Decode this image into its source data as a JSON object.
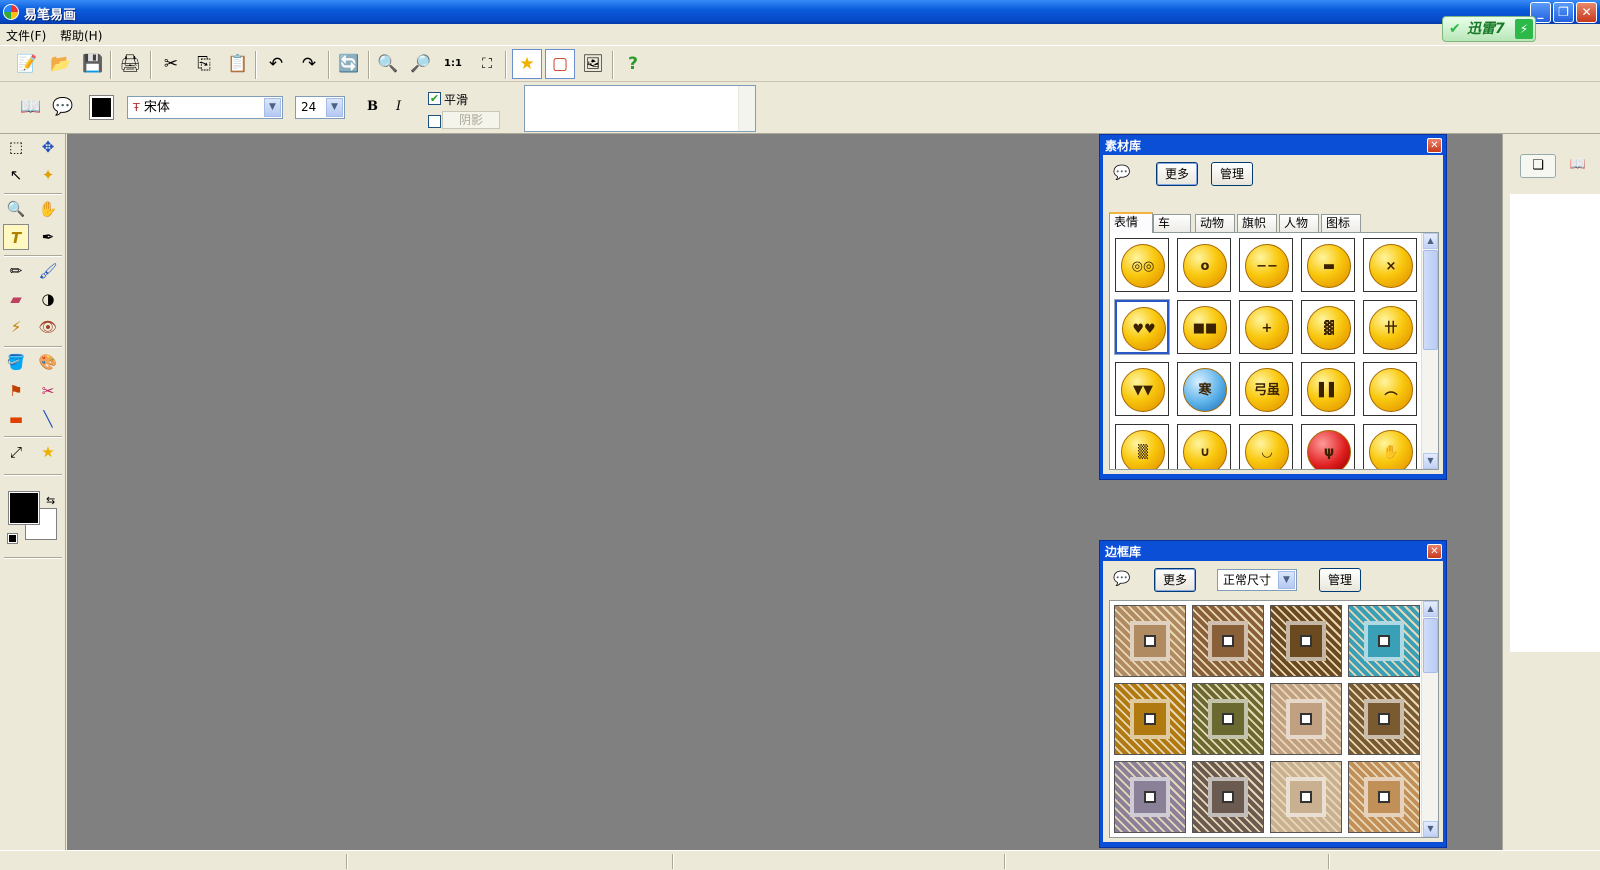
{
  "window": {
    "title": "易笔易画"
  },
  "badge": {
    "label": "迅雷7",
    "bolt": "⚡"
  },
  "menu": [
    {
      "label": "文件(F)"
    },
    {
      "label": "帮助(H)"
    }
  ],
  "text_toolbar": {
    "font_name": "宋体",
    "font_size": "24",
    "bold_label": "B",
    "italic_label": "I",
    "smooth_label": "平滑",
    "smooth_checked": true,
    "shadow_label": "阴影",
    "shadow_checked": false,
    "text_value": "",
    "text_color": "#000000"
  },
  "material_panel": {
    "title": "素材库",
    "more_label": "更多",
    "manage_label": "管理",
    "tabs": [
      "表情",
      "车",
      "动物",
      "旗帜",
      "人物",
      "图标"
    ],
    "active_tab": "表情",
    "cells": [
      {
        "glyph": "◎◎"
      },
      {
        "glyph": "o"
      },
      {
        "glyph": "−−"
      },
      {
        "glyph": "▬"
      },
      {
        "glyph": "×"
      },
      {
        "glyph": "♥♥"
      },
      {
        "glyph": "■■"
      },
      {
        "glyph": "+"
      },
      {
        "glyph": "▓"
      },
      {
        "glyph": "卄"
      },
      {
        "glyph": "▼▼"
      },
      {
        "glyph": "寒"
      },
      {
        "glyph": "弓虽"
      },
      {
        "glyph": "▌▌"
      },
      {
        "glyph": "︵"
      },
      {
        "glyph": "▒"
      },
      {
        "glyph": "∪"
      },
      {
        "glyph": "◡"
      },
      {
        "glyph": "ψ"
      },
      {
        "glyph": "✋"
      }
    ]
  },
  "frame_panel": {
    "title": "边框库",
    "more_label": "更多",
    "size_option": "正常尺寸",
    "manage_label": "管理",
    "frames": [
      {
        "color": "#b08a60"
      },
      {
        "color": "#8a6038"
      },
      {
        "color": "#6b4a20"
      },
      {
        "color": "#3aa0b8"
      },
      {
        "color": "#b07a10"
      },
      {
        "color": "#6a6a30"
      },
      {
        "color": "#c0a080"
      },
      {
        "color": "#7a5a30"
      },
      {
        "color": "#8a8098"
      },
      {
        "color": "#6a5a50"
      },
      {
        "color": "#c8b090"
      },
      {
        "color": "#c09058"
      }
    ]
  }
}
